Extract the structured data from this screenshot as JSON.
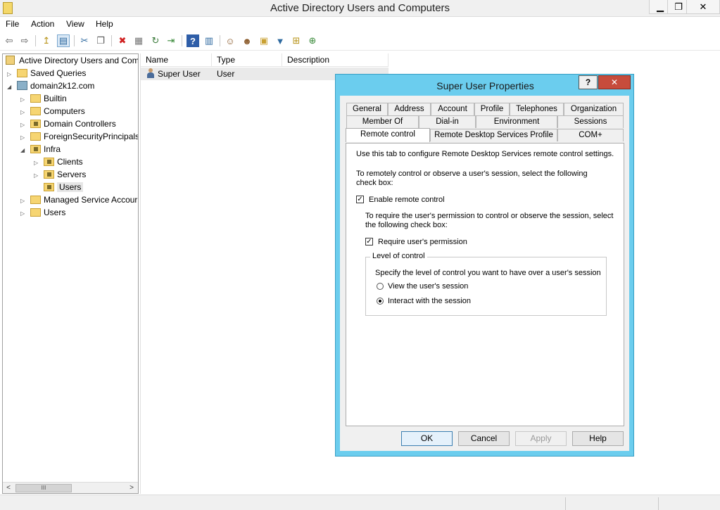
{
  "window": {
    "title": "Active Directory Users and Computers",
    "min_glyph": "▁",
    "max_glyph": "❐",
    "close_glyph": "✕"
  },
  "menu": [
    "File",
    "Action",
    "View",
    "Help"
  ],
  "toolbar": {
    "icons": [
      "back-arrow-icon",
      "forward-arrow-icon",
      "up-folder-icon",
      "show-hide-tree-icon",
      "cut-icon",
      "copy-icon",
      "delete-icon",
      "properties-icon",
      "refresh-icon",
      "export-list-icon",
      "help-icon",
      "console-tree-icon",
      "new-user-icon",
      "new-group-icon",
      "new-ou-icon",
      "filter-icon",
      "add-to-group-icon",
      "delegate-icon"
    ],
    "glyphs": [
      "⇦",
      "⇨",
      "↥",
      "▤",
      "✂",
      "❐",
      "✖",
      "▦",
      "↻",
      "⇥",
      "?",
      "▥",
      "☺",
      "☻",
      "▣",
      "▼",
      "⊞",
      "⊕"
    ]
  },
  "tree": {
    "root": "Active Directory Users and Com",
    "saved_queries": "Saved Queries",
    "domain": "domain2k12.com",
    "builtin": "Builtin",
    "computers": "Computers",
    "domain_controllers": "Domain Controllers",
    "foreign": "ForeignSecurityPrincipals",
    "infra": "Infra",
    "clients": "Clients",
    "servers": "Servers",
    "users_ou": "Users",
    "managed": "Managed Service Accour",
    "users": "Users",
    "expand_glyph": "▷",
    "collapse_glyph": "◢"
  },
  "hscroll": {
    "left": "<",
    "right": ">",
    "thumb": "III"
  },
  "list": {
    "columns": [
      "Name",
      "Type",
      "Description"
    ],
    "rows": [
      {
        "name": "Super User",
        "type": "User",
        "description": ""
      }
    ]
  },
  "dialog": {
    "title": "Super User Properties",
    "help": "?",
    "close": "✕",
    "tabs_row1": [
      "General",
      "Address",
      "Account",
      "Profile",
      "Telephones",
      "Organization"
    ],
    "tabs_row2": [
      "Member Of",
      "Dial-in",
      "Environment",
      "Sessions"
    ],
    "tabs_row3": [
      "Remote control",
      "Remote Desktop Services Profile",
      "COM+"
    ],
    "intro": "Use this tab to configure Remote Desktop Services remote control settings.",
    "instruction1_line1": "To remotely control or observe a user's session, select the following",
    "instruction1_line2": "check box:",
    "enable_label": "Enable remote control",
    "enable_checked": true,
    "instruction2_line1": "To require the user's permission to control or observe the session, select",
    "instruction2_line2": "the following check box:",
    "require_label": "Require user's permission",
    "require_checked": true,
    "check_glyph": "✓",
    "level_legend": "Level of control",
    "level_desc": "Specify the level of control you want to have over a user's session",
    "option_view": "View the user's session",
    "option_interact": "Interact with the session",
    "selected_option": "interact",
    "buttons": {
      "ok": "OK",
      "cancel": "Cancel",
      "apply": "Apply",
      "help": "Help"
    }
  }
}
